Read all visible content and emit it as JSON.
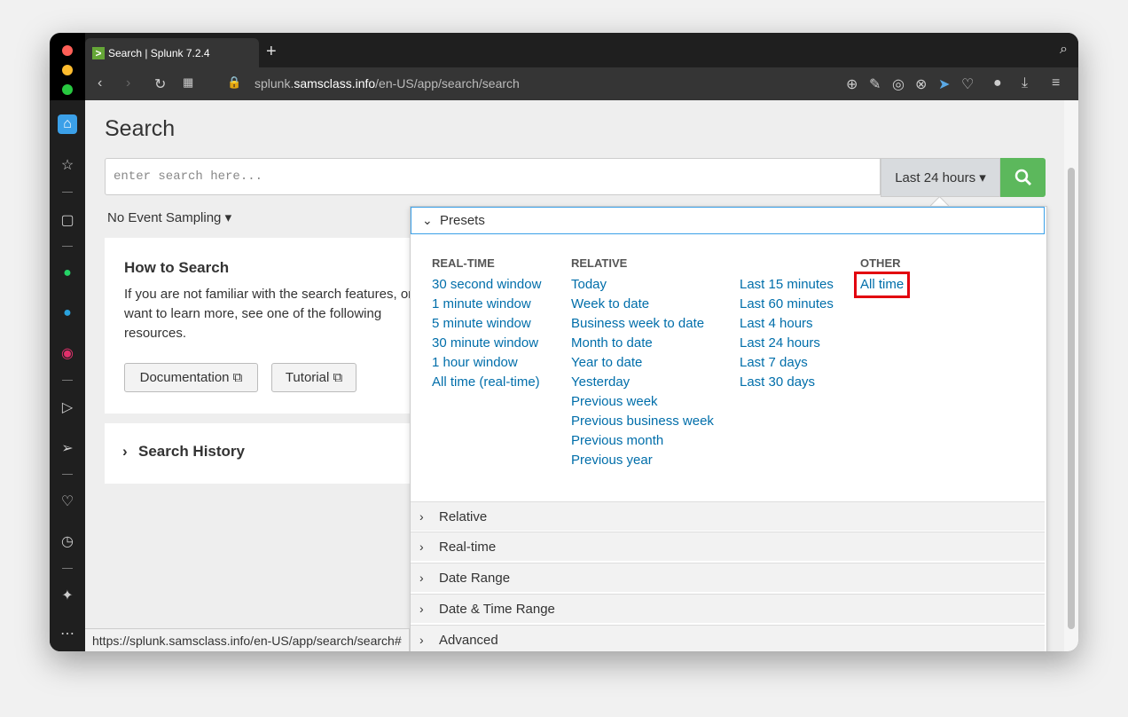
{
  "browser": {
    "tab_title": "Search | Splunk 7.2.4",
    "new_tab": "+",
    "url_prefix": "splunk.",
    "url_domain": "samsclass.info",
    "url_path": "/en-US/app/search/search",
    "status_url": "https://splunk.samsclass.info/en-US/app/search/search#"
  },
  "page": {
    "title": "Search",
    "search_placeholder": "enter search here...",
    "time_picker_label": "Last 24 hours ▾",
    "event_sampling": "No Event Sampling ▾"
  },
  "how_to": {
    "heading": "How to Search",
    "text": "If you are not familiar with the search features, or want to learn more, see one of the following resources.",
    "documentation_label": "Documentation ⧉",
    "tutorial_label": "Tutorial ⧉"
  },
  "history": {
    "label": "Search History"
  },
  "dropdown": {
    "presets_label": "Presets",
    "realtime_header": "REAL-TIME",
    "relative_header": "RELATIVE",
    "other_header": "OTHER",
    "realtime": [
      "30 second window",
      "1 minute window",
      "5 minute window",
      "30 minute window",
      "1 hour window",
      "All time (real-time)"
    ],
    "relative_a": [
      "Today",
      "Week to date",
      "Business week to date",
      "Month to date",
      "Year to date",
      "Yesterday",
      "Previous week",
      "Previous business week",
      "Previous month",
      "Previous year"
    ],
    "relative_b": [
      "Last 15 minutes",
      "Last 60 minutes",
      "Last 4 hours",
      "Last 24 hours",
      "Last 7 days",
      "Last 30 days"
    ],
    "other": [
      "All time"
    ],
    "sections": [
      "Relative",
      "Real-time",
      "Date Range",
      "Date & Time Range",
      "Advanced"
    ]
  },
  "colors": {
    "link": "#006eaa",
    "go_button": "#5cb85c",
    "highlight": "#e2000f",
    "focus": "#3ba0e8"
  }
}
